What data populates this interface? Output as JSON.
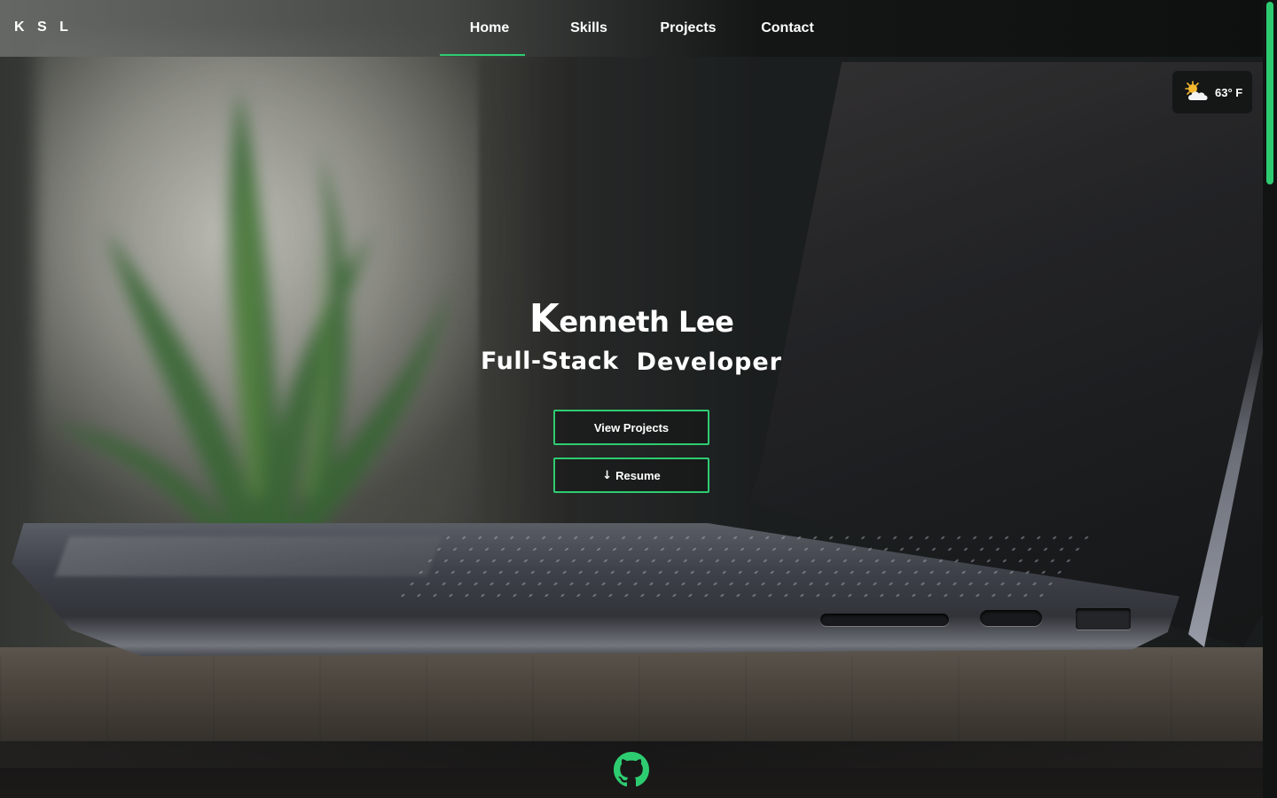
{
  "logo": "K S L",
  "nav": {
    "items": [
      {
        "label": "Home",
        "active": true
      },
      {
        "label": "Skills",
        "active": false
      },
      {
        "label": "Projects",
        "active": false
      },
      {
        "label": "Contact",
        "active": false
      }
    ]
  },
  "weather": {
    "temp": "63° F",
    "icon": "partly-cloudy-sun-icon"
  },
  "hero": {
    "name_initial": "K",
    "name_rest": "enneth Lee",
    "role_highlight": "Full-Stack",
    "role_rest": "Developer",
    "buttons": {
      "view_projects": "View Projects",
      "resume": "Resume",
      "resume_icon": "↓"
    }
  },
  "footer": {
    "icon": "github-icon"
  },
  "colors": {
    "accent": "#2ecc71",
    "nav_bg": "#141616",
    "text": "#ffffff"
  }
}
